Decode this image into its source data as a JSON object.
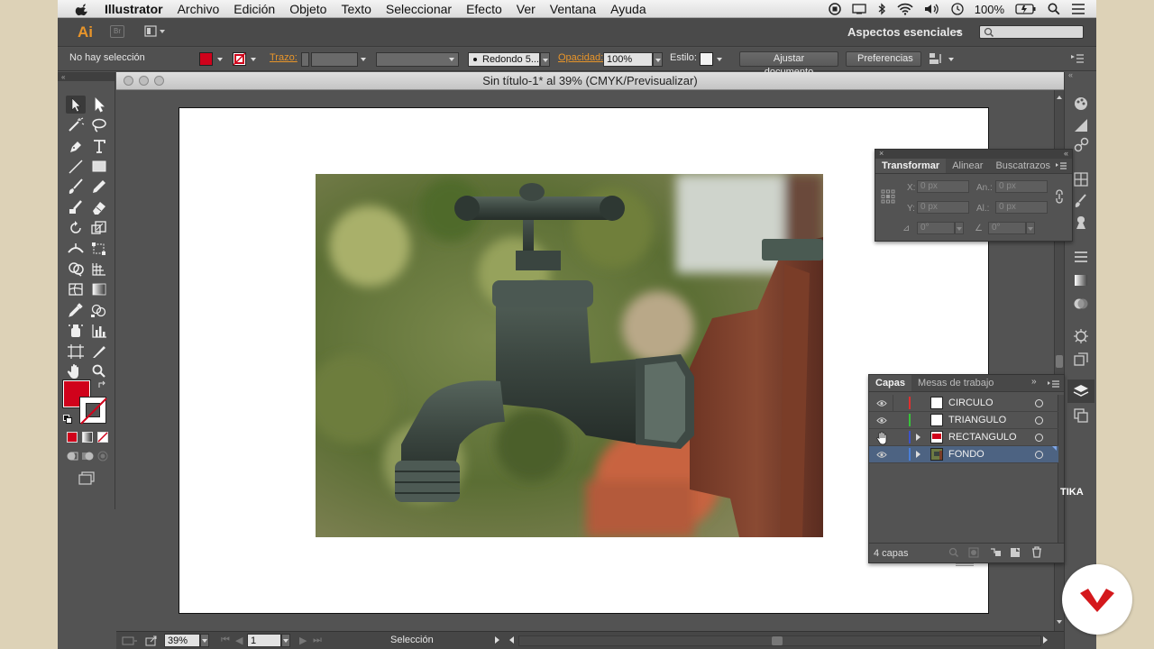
{
  "menubar": {
    "app": "Illustrator",
    "items": [
      "Archivo",
      "Edición",
      "Objeto",
      "Texto",
      "Seleccionar",
      "Efecto",
      "Ver",
      "Ventana",
      "Ayuda"
    ],
    "battery": "100%"
  },
  "appbar": {
    "logo": "Ai",
    "bridge": "Br",
    "workspace": "Aspectos esenciales"
  },
  "control": {
    "selection": "No hay selección",
    "stroke_label": "Trazo:",
    "brush": "Redondo 5...",
    "opacity_label": "Opacidad:",
    "opacity_value": "100%",
    "style_label": "Estilo:",
    "document_setup": "Ajustar documento",
    "preferences": "Preferencias",
    "fill_color": "#d0021b"
  },
  "document": {
    "title": "Sin título-1* al 39% (CMYK/Previsualizar)"
  },
  "status": {
    "zoom": "39%",
    "artboard": "1",
    "tool": "Selección"
  },
  "transform": {
    "tabs": [
      "Transformar",
      "Alinear",
      "Buscatrazos"
    ],
    "x_label": "X:",
    "x_value": "0 px",
    "y_label": "Y:",
    "y_value": "0 px",
    "w_label": "An.:",
    "w_value": "0 px",
    "h_label": "Al.:",
    "h_value": "0 px",
    "angle_value": "0°",
    "shear_value": "0°"
  },
  "layers": {
    "tabs": [
      "Capas",
      "Mesas de trabajo"
    ],
    "rows": [
      {
        "name": "CIRCULO",
        "color": "#e0302f"
      },
      {
        "name": "TRIANGULO",
        "color": "#38c23a"
      },
      {
        "name": "RECTANGULO",
        "color": "#3d53c9"
      },
      {
        "name": "FONDO",
        "color": "#4a7ed8"
      }
    ],
    "count": "4 capas"
  },
  "background_text": "TIKA"
}
